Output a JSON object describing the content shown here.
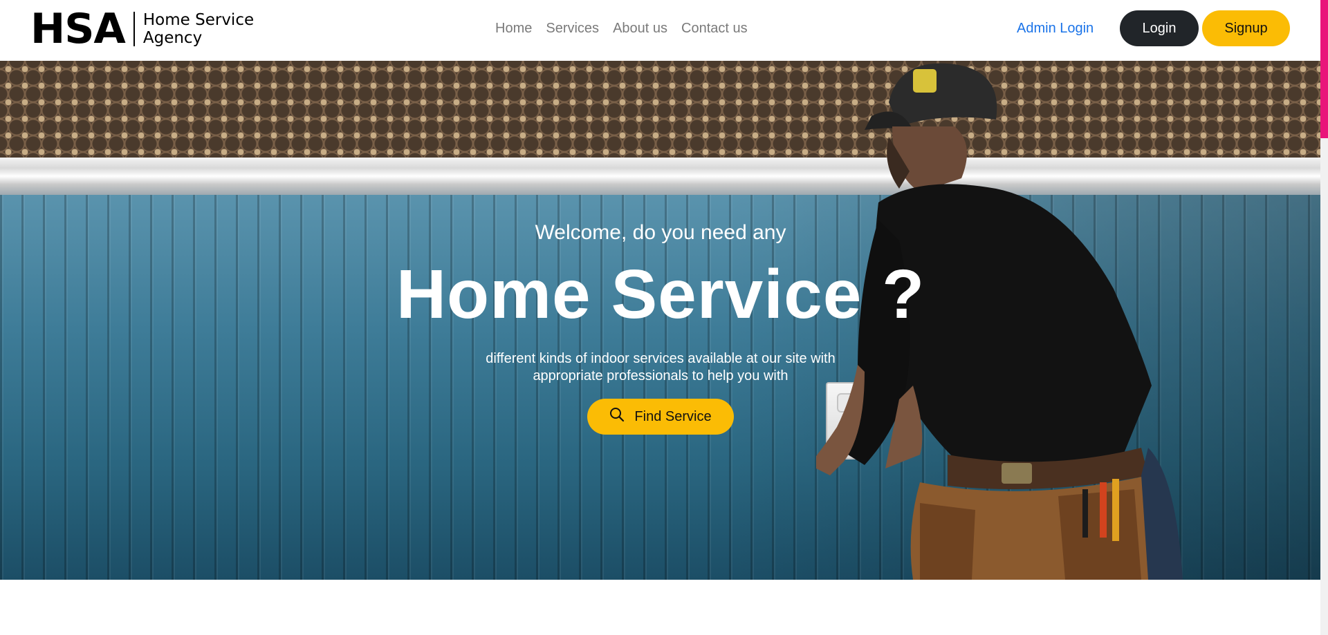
{
  "brand": {
    "mark": "HSA",
    "name_line1": "Home Service",
    "name_line2": "Agency"
  },
  "nav": {
    "items": [
      {
        "label": "Home"
      },
      {
        "label": "Services"
      },
      {
        "label": "About us"
      },
      {
        "label": "Contact us"
      }
    ]
  },
  "header_actions": {
    "admin_login": "Admin Login",
    "login": "Login",
    "signup": "Signup"
  },
  "hero": {
    "pre_title": "Welcome, do you need any",
    "title": "Home Service ?",
    "description_line1": "different kinds of indoor services available at our site with",
    "description_line2": "appropriate professionals to help you with",
    "cta_label": "Find Service",
    "cta_icon": "search-icon"
  },
  "colors": {
    "accent_yellow": "#fbbc05",
    "dark_button": "#212529",
    "link_blue": "#1a73e8",
    "nav_gray": "#7a7a7a",
    "scroll_accent": "#e9157a"
  }
}
